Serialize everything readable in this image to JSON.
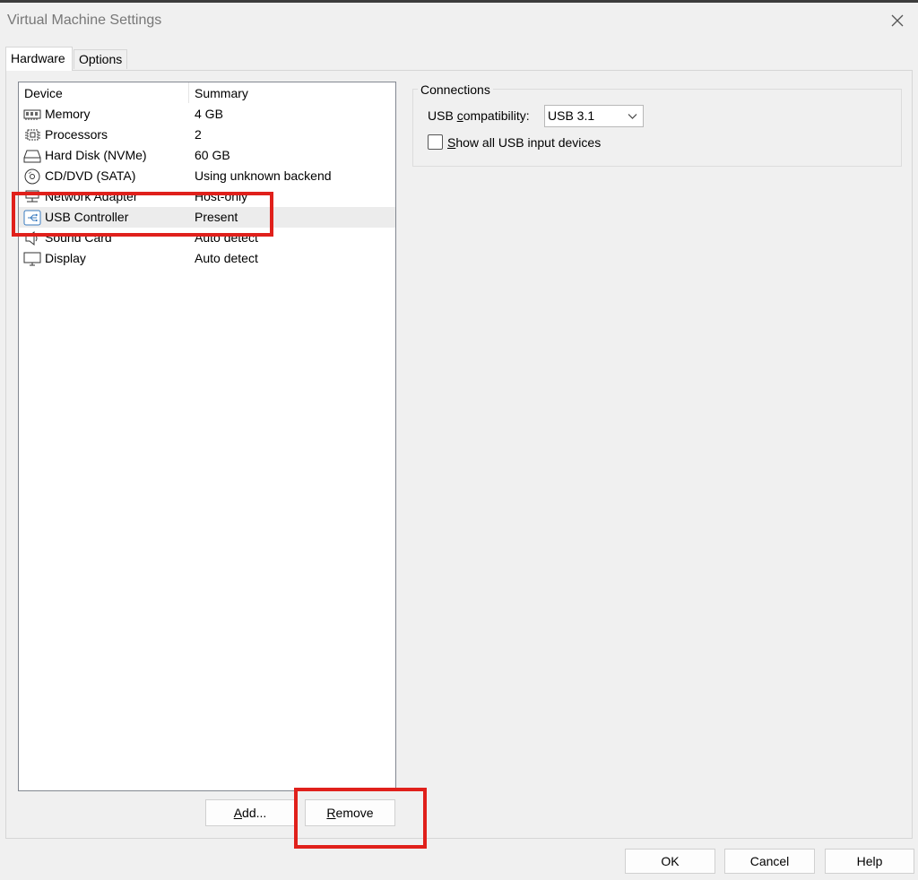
{
  "window": {
    "title": "Virtual Machine Settings"
  },
  "tabs": [
    {
      "label": "Hardware",
      "active": true
    },
    {
      "label": "Options",
      "active": false
    }
  ],
  "device_list": {
    "columns": [
      "Device",
      "Summary"
    ],
    "rows": [
      {
        "icon": "memory-icon",
        "device": "Memory",
        "summary": "4 GB"
      },
      {
        "icon": "processor-icon",
        "device": "Processors",
        "summary": "2"
      },
      {
        "icon": "hard-disk-icon",
        "device": "Hard Disk (NVMe)",
        "summary": "60 GB"
      },
      {
        "icon": "cd-dvd-icon",
        "device": "CD/DVD (SATA)",
        "summary": "Using unknown backend"
      },
      {
        "icon": "network-adapter-icon",
        "device": "Network Adapter",
        "summary": "Host-only"
      },
      {
        "icon": "usb-icon",
        "device": "USB Controller",
        "summary": "Present",
        "selected": true
      },
      {
        "icon": "sound-card-icon",
        "device": "Sound Card",
        "summary": "Auto detect"
      },
      {
        "icon": "display-icon",
        "device": "Display",
        "summary": "Auto detect"
      }
    ]
  },
  "buttons": {
    "add": {
      "label_prefix": "",
      "label_underlined": "A",
      "label_suffix": "dd..."
    },
    "remove": {
      "label_prefix": "",
      "label_underlined": "R",
      "label_suffix": "emove"
    },
    "ok": "OK",
    "cancel": "Cancel",
    "help": "Help"
  },
  "connections": {
    "group_title": "Connections",
    "usb_compat_label_prefix": "USB ",
    "usb_compat_label_underlined": "c",
    "usb_compat_label_suffix": "ompatibility:",
    "usb_compat_value": "USB 3.1",
    "show_all_label_prefix": "",
    "show_all_label_underlined": "S",
    "show_all_label_suffix": "how all USB input devices",
    "show_all_checked": false
  },
  "annotations": {
    "highlight_color": "#e0201b"
  }
}
